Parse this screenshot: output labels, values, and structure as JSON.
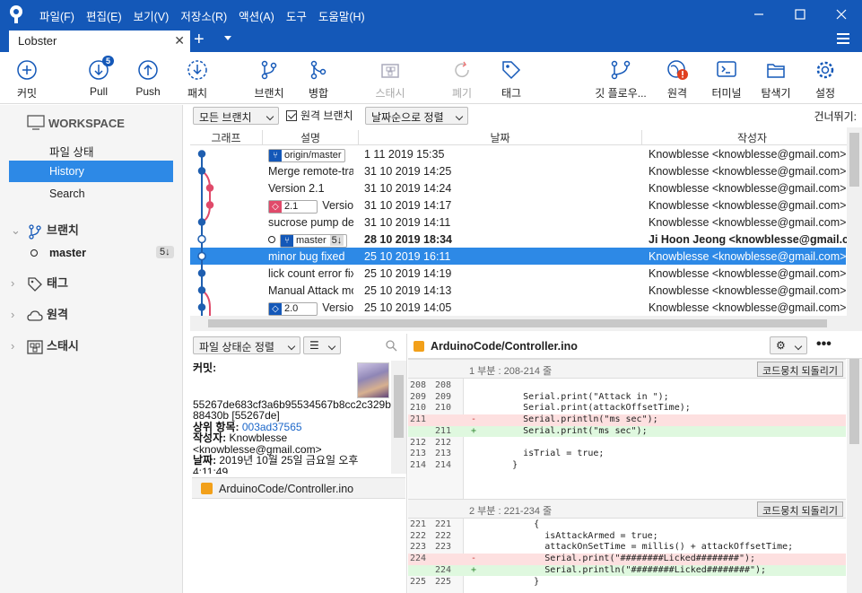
{
  "titlebar": {
    "menu": [
      "파일(F)",
      "편집(E)",
      "보기(V)",
      "저장소(R)",
      "액션(A)",
      "도구",
      "도움말(H)"
    ]
  },
  "tab": {
    "label": "Lobster"
  },
  "toolbar": {
    "commit": "커밋",
    "pull": "Pull",
    "pull_badge": "5",
    "push": "Push",
    "fetch": "패치",
    "branch": "브랜치",
    "merge": "병합",
    "stash": "스태시",
    "discard": "폐기",
    "tag": "태그",
    "git_flow": "깃 플로우...",
    "remote": "원격",
    "terminal": "터미널",
    "explorer": "탐색기",
    "settings": "설정"
  },
  "sidebar": {
    "workspace": "WORKSPACE",
    "file_status": "파일 상태",
    "history": "History",
    "search": "Search",
    "branches": "브랜치",
    "master": "master",
    "master_badge": "5↓",
    "tags": "태그",
    "remotes": "원격",
    "stashes": "스태시"
  },
  "filter": {
    "branches": "모든 브랜치",
    "remote_branches": "원격 브랜치",
    "sort": "날짜순으로 정렬",
    "skip": "건너뛰기:"
  },
  "history": {
    "headers": {
      "graph": "그래프",
      "desc": "설명",
      "date": "날짜",
      "author": "작성자"
    },
    "rows": [
      {
        "ref": "origin/master",
        "desc": "",
        "date": "1 11 2019 15:35",
        "author": "Knowblesse <knowblesse@gmail.com>"
      },
      {
        "desc": "Merge remote-tracking branch",
        "date": "31 10 2019 14:25",
        "author": "Knowblesse <knowblesse@gmail.com>"
      },
      {
        "desc": "Version 2.1",
        "date": "31 10 2019 14:24",
        "author": "Knowblesse <knowblesse@gmail.com>"
      },
      {
        "tag": "2.1",
        "desc": "Version",
        "date": "31 10 2019 14:17",
        "author": "Knowblesse <knowblesse@gmail.com>"
      },
      {
        "desc": "sucrose pump delay",
        "date": "31 10 2019 14:11",
        "author": "Knowblesse <knowblesse@gmail.com>"
      },
      {
        "ref": "master",
        "ref_badge": "5↓",
        "desc": "",
        "date": "28 10 2019 18:34",
        "author": "Ji Hoon Jeong <knowblesse@gmail.com>"
      },
      {
        "desc": "minor bug fixed",
        "date": "25 10 2019 16:11",
        "author": "Knowblesse <knowblesse@gmail.com>"
      },
      {
        "desc": "lick count error fix",
        "date": "25 10 2019 14:19",
        "author": "Knowblesse <knowblesse@gmail.com>"
      },
      {
        "desc": "Manual Attack mode",
        "date": "25 10 2019 14:13",
        "author": "Knowblesse <knowblesse@gmail.com>"
      },
      {
        "tag": "2.0",
        "desc": "Version",
        "date": "25 10 2019 14:05",
        "author": "Knowblesse <knowblesse@gmail.com>"
      }
    ]
  },
  "files": {
    "sort": "파일 상태순 정렬",
    "commit_label": "커밋:",
    "hash": "55267de683cf3a6b95534567b8cc2c329b88430b [55267de]",
    "parent_label": "상위 항목:",
    "parent": "003ad37565",
    "author_label": "작성자:",
    "author": "Knowblesse <knowblesse@gmail.com>",
    "date_label": "날짜:",
    "date": "2019년 10월 25일 금요일 오후 4:11:49",
    "file": "ArduinoCode/Controller.ino"
  },
  "diff": {
    "file": "ArduinoCode/Controller.ino",
    "discard_label": "코드뭉치 되돌리기",
    "hunk1_label": "1 부분 : 208-214 줄",
    "hunk2_label": "2 부분 : 221-234 줄",
    "hunk1": [
      {
        "o": "208",
        "n": "208",
        "m": "",
        "c": ""
      },
      {
        "o": "209",
        "n": "209",
        "m": "",
        "c": "      Serial.print(\"Attack in \");"
      },
      {
        "o": "210",
        "n": "210",
        "m": "",
        "c": "      Serial.print(attackOffsetTime);"
      },
      {
        "o": "211",
        "n": "",
        "m": "-",
        "c": "      Serial.println(\"ms sec\");"
      },
      {
        "o": "",
        "n": "211",
        "m": "+",
        "c": "      Serial.print(\"ms sec\");"
      },
      {
        "o": "212",
        "n": "212",
        "m": "",
        "c": ""
      },
      {
        "o": "213",
        "n": "213",
        "m": "",
        "c": "      isTrial = true;"
      },
      {
        "o": "214",
        "n": "214",
        "m": "",
        "c": "    }"
      }
    ],
    "hunk2": [
      {
        "o": "221",
        "n": "221",
        "m": "",
        "c": "        {"
      },
      {
        "o": "222",
        "n": "222",
        "m": "",
        "c": "          isAttackArmed = true;"
      },
      {
        "o": "223",
        "n": "223",
        "m": "",
        "c": "          attackOnSetTime = millis() + attackOffsetTime;"
      },
      {
        "o": "224",
        "n": "",
        "m": "-",
        "c": "          Serial.print(\"########Licked########\");"
      },
      {
        "o": "",
        "n": "224",
        "m": "+",
        "c": "          Serial.println(\"########Licked########\");"
      },
      {
        "o": "225",
        "n": "225",
        "m": "",
        "c": "        }"
      }
    ]
  }
}
